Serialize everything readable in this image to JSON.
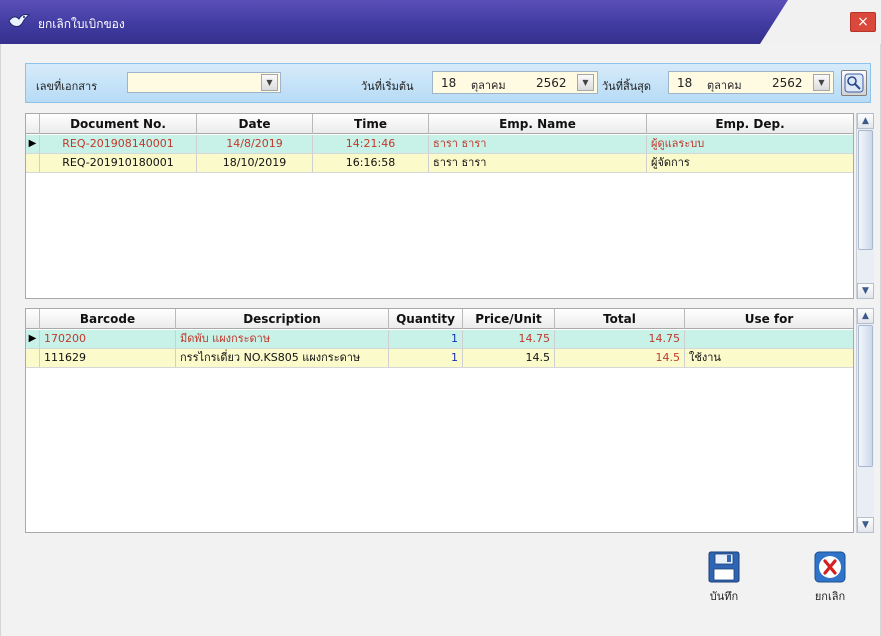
{
  "window": {
    "title": "ยกเลิกใบเบิกของ",
    "close_symbol": "×"
  },
  "filters": {
    "doc_no_label": "เลขที่เอกสาร",
    "doc_no_value": "",
    "start_label": "วันที่เริ่มต้น",
    "start_date": {
      "day": "18",
      "month": "ตุลาคม",
      "year": "2562"
    },
    "end_label": "วันที่สิ้นสุด",
    "end_date": {
      "day": "18",
      "month": "ตุลาคม",
      "year": "2562"
    },
    "dropdown_symbol": "▼"
  },
  "doc_grid": {
    "headers": [
      "Document No.",
      "Date",
      "Time",
      "Emp. Name",
      "Emp. Dep."
    ],
    "rows": [
      {
        "doc_no": "REQ-201908140001",
        "date": "14/8/2019",
        "time": "14:21:46",
        "emp_name": "ธารา ธารา",
        "emp_dep": "ผู้ดูแลระบบ",
        "selected": true
      },
      {
        "doc_no": "REQ-201910180001",
        "date": "18/10/2019",
        "time": "16:16:58",
        "emp_name": "ธารา ธารา",
        "emp_dep": "ผู้จัดการ",
        "selected": false
      }
    ]
  },
  "item_grid": {
    "headers": [
      "Barcode",
      "Description",
      "Quantity",
      "Price/Unit",
      "Total",
      "Use for"
    ],
    "rows": [
      {
        "barcode": "170200",
        "description": "มีดพับ แผงกระดาษ",
        "quantity": "1",
        "price": "14.75",
        "total": "14.75",
        "use_for": "",
        "selected": true
      },
      {
        "barcode": "111629",
        "description": "กรรไกรเดี่ยว NO.KS805 แผงกระดาษ",
        "quantity": "1",
        "price": "14.5",
        "total": "14.5",
        "use_for": "ใช้งาน",
        "selected": false
      }
    ]
  },
  "actions": {
    "save_label": "บันทึก",
    "cancel_label": "ยกเลิก"
  },
  "icons": {
    "app": "app-bird-icon",
    "search": "search-icon",
    "save": "floppy-disk-icon",
    "cancel": "red-x-icon"
  },
  "colors": {
    "titlebar": "#3f3a9e",
    "filterbar": "#b7dbf5",
    "selected_row": "#c8f1e8",
    "normal_row": "#fbfacb",
    "red_text": "#c0392b",
    "blue_text": "#1a2fb5"
  }
}
